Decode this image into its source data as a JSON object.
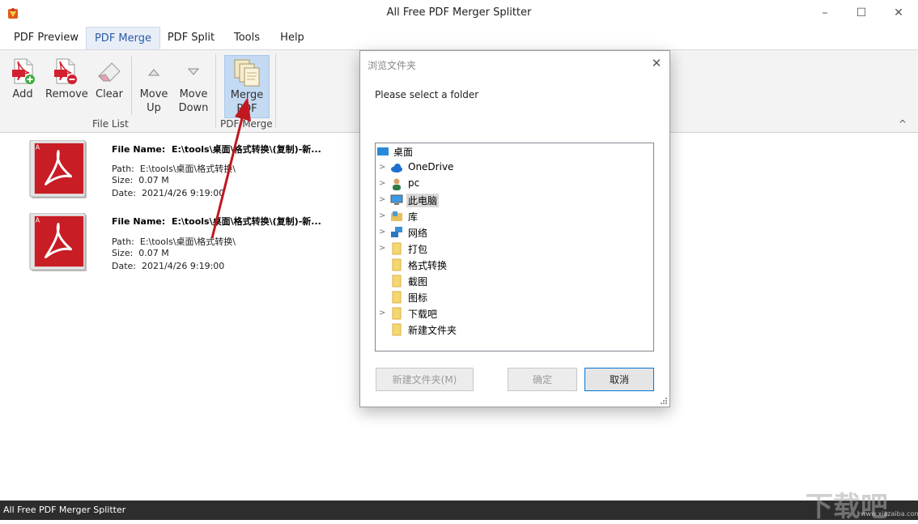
{
  "window": {
    "title": "All Free PDF Merger Splitter",
    "min_icon": "–",
    "max_icon": "☐",
    "close_icon": "✕"
  },
  "tabs": [
    {
      "label": "PDF Preview"
    },
    {
      "label": "PDF Merge"
    },
    {
      "label": "PDF Split"
    },
    {
      "label": "Tools"
    },
    {
      "label": "Help"
    }
  ],
  "ribbon": {
    "add": "Add",
    "remove": "Remove",
    "clear": "Clear",
    "move_up_1": "Move",
    "move_up_2": "Up",
    "move_down_1": "Move",
    "move_down_2": "Down",
    "merge_1": "Merge",
    "merge_2": "PDF",
    "group_file_list": "File List",
    "group_pdf_merge": "PDF Merge",
    "collapse_icon": "^"
  },
  "files": [
    {
      "name_label": "File Name:",
      "name": "E:\\tools\\桌面\\格式转换\\(复制)-新...",
      "path_label": "Path:",
      "path": "E:\\tools\\桌面\\格式转换\\",
      "size_label": "Size:",
      "size": "0.07 M",
      "date_label": "Date:",
      "date": "2021/4/26 9:19:00"
    },
    {
      "name_label": "File Name:",
      "name": "E:\\tools\\桌面\\格式转换\\(复制)-新...",
      "path_label": "Path:",
      "path": "E:\\tools\\桌面\\格式转换\\",
      "size_label": "Size:",
      "size": "0.07 M",
      "date_label": "Date:",
      "date": "2021/4/26 9:19:00"
    }
  ],
  "dialog": {
    "title": "浏览文件夹",
    "close": "✕",
    "prompt": "Please select a folder",
    "tree": [
      {
        "label": "桌面"
      },
      {
        "label": "OneDrive"
      },
      {
        "label": "pc"
      },
      {
        "label": "此电脑"
      },
      {
        "label": "库"
      },
      {
        "label": "网络"
      },
      {
        "label": "打包"
      },
      {
        "label": "格式转换"
      },
      {
        "label": "截图"
      },
      {
        "label": "图标"
      },
      {
        "label": "下载吧"
      },
      {
        "label": "新建文件夹"
      }
    ],
    "new_folder_button": "新建文件夹(M)",
    "ok_button": "确定",
    "cancel_button": "取消"
  },
  "status": {
    "text": "All Free PDF Merger Splitter"
  },
  "watermark": {
    "text": "下载吧",
    "url": "www.xiazaiba.com"
  }
}
